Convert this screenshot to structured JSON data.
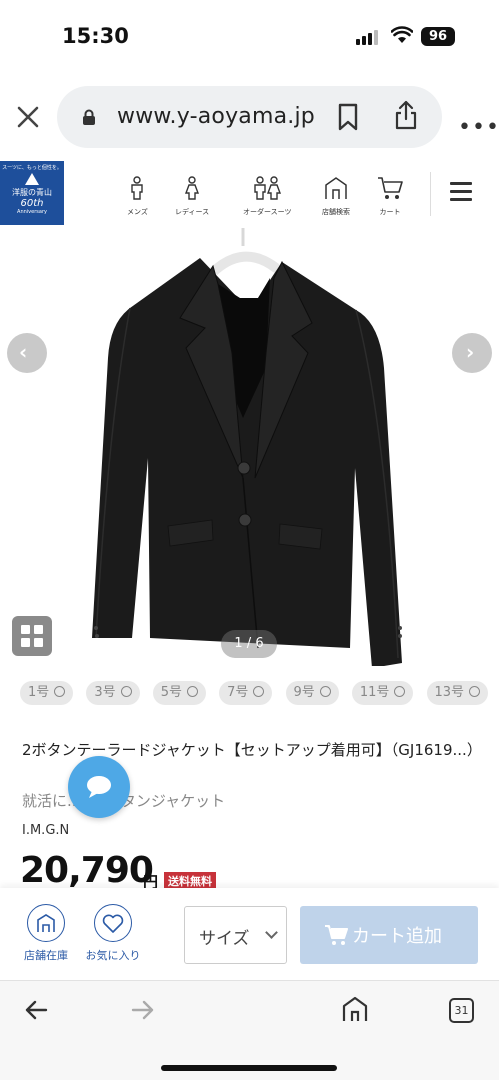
{
  "status": {
    "time": "15:30",
    "battery": "96"
  },
  "browser": {
    "url": "www.y-aoyama.jp"
  },
  "site": {
    "logo": {
      "tagline": "スーツに、もっと個性を。",
      "brand": "洋服の青山",
      "years": "60th",
      "anniv": "Anniversary"
    },
    "nav": [
      {
        "label": "メンズ",
        "icon": "man-icon"
      },
      {
        "label": "レディース",
        "icon": "woman-icon"
      },
      {
        "label": "オーダースーツ",
        "icon": "couple-icon"
      },
      {
        "label": "店舗検索",
        "icon": "store-icon"
      },
      {
        "label": "カート",
        "icon": "cart-icon"
      }
    ]
  },
  "gallery": {
    "counter": "1 / 6"
  },
  "sizes": [
    "1号",
    "3号",
    "5号",
    "7号",
    "9号",
    "11号",
    "13号"
  ],
  "product": {
    "title": "2ボタンテーラードジャケット【セットアップ着用可】（GJ1619...）",
    "subtitle": "就活に...の2ボタンジャケット",
    "brand": "I.M.G.N",
    "price": "20,790",
    "yen": "円",
    "shipping_badge": "送料無料"
  },
  "actions": {
    "store_stock": "店舗在庫",
    "favorite": "お気に入り",
    "size_select": "サイズ",
    "add_to_cart": "カート追加"
  },
  "toolbar": {
    "tabs_count": "31"
  },
  "colors": {
    "brand_blue": "#1e4f9b",
    "accent_blue": "#2b5aa6",
    "cart_disabled": "#bfd3ea",
    "badge_red": "#c7323a",
    "chat": "#4ea8e6"
  }
}
